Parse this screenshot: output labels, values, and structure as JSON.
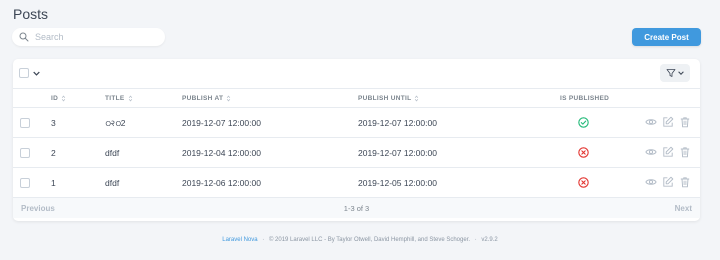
{
  "header": {
    "title": "Posts",
    "search_placeholder": "Search",
    "create_label": "Create Post"
  },
  "table": {
    "columns": {
      "id": "ID",
      "title": "TITLE",
      "publish_at": "PUBLISH AT",
      "publish_until": "PUBLISH UNTIL",
      "is_published": "IS PUBLISHED"
    },
    "rows": [
      {
        "id": "3",
        "title": "ഠ२ഠ2",
        "publish_at": "2019-12-07 12:00:00",
        "publish_until": "2019-12-07 12:00:00",
        "published": true
      },
      {
        "id": "2",
        "title": "dfdf",
        "publish_at": "2019-12-04 12:00:00",
        "publish_until": "2019-12-07 12:00:00",
        "published": false
      },
      {
        "id": "1",
        "title": "dfdf",
        "publish_at": "2019-12-06 12:00:00",
        "publish_until": "2019-12-05 12:00:00",
        "published": false
      }
    ]
  },
  "pagination": {
    "previous": "Previous",
    "count": "1-3 of 3",
    "next": "Next"
  },
  "footer": {
    "brand": "Laravel Nova",
    "copyright": "© 2019 Laravel LLC - By Taylor Otwell, David Hemphill, and Steve Schoger.",
    "version": "v2.9.2"
  },
  "colors": {
    "accent": "#4099de",
    "success": "#21b978",
    "danger": "#e3342f"
  }
}
